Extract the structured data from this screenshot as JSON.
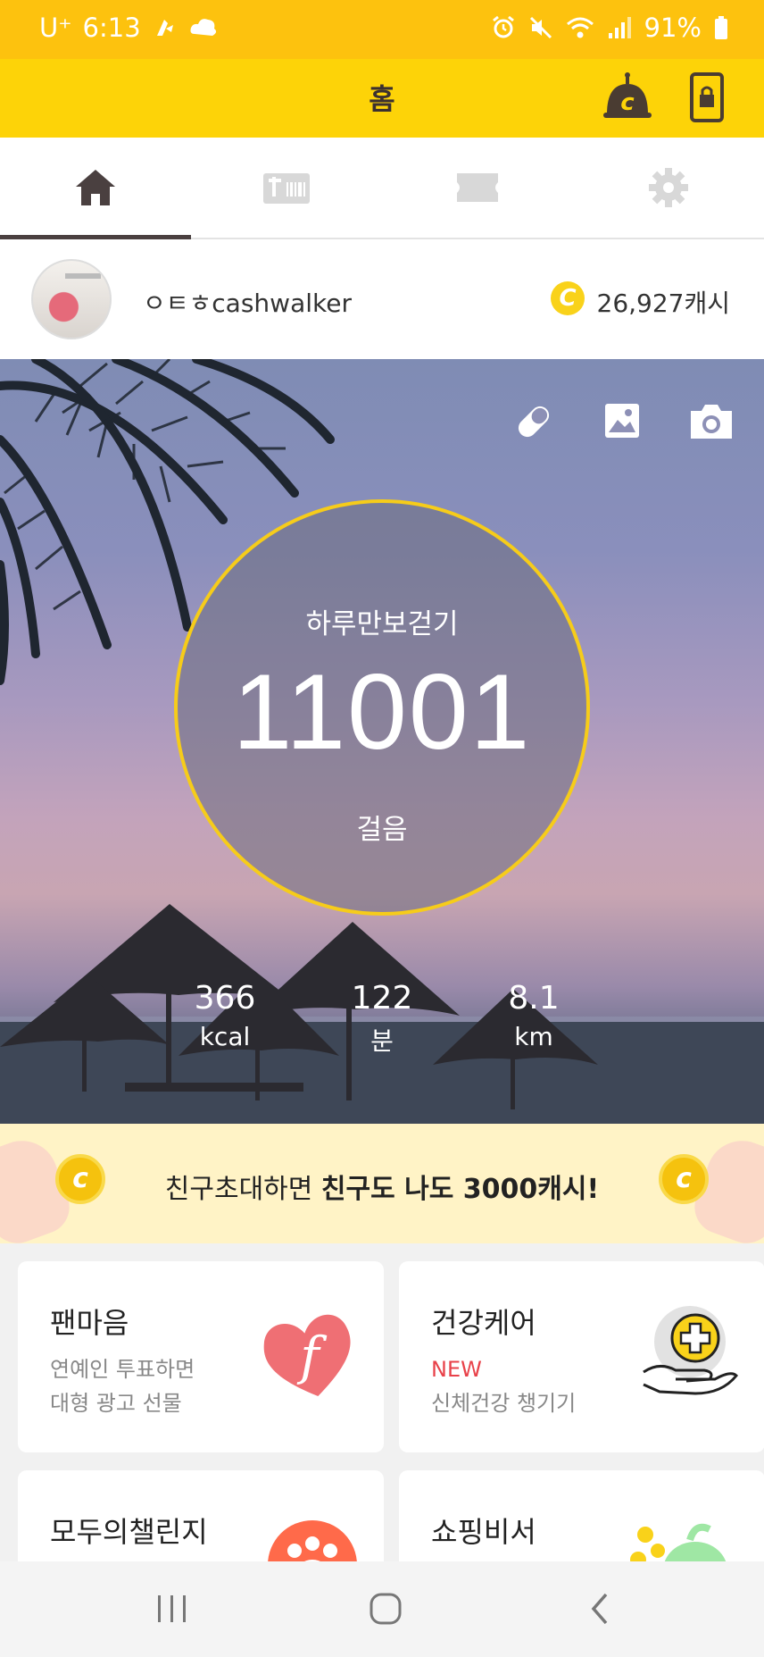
{
  "status_bar": {
    "carrier": "U⁺",
    "time": "6:13",
    "battery": "91%"
  },
  "app_bar": {
    "title": "홈"
  },
  "tabs": [
    {
      "name": "home",
      "icon": "home-icon",
      "active": true
    },
    {
      "name": "shop",
      "icon": "store-icon",
      "active": false
    },
    {
      "name": "coupon",
      "icon": "ticket-icon",
      "active": false
    },
    {
      "name": "settings",
      "icon": "gear-icon",
      "active": false
    }
  ],
  "profile": {
    "username": "ㅇㅌㅎcashwalker",
    "coin_symbol": "C",
    "cash": "26,927캐시"
  },
  "hero": {
    "goal_label": "하루만보걷기",
    "steps": "11001",
    "steps_unit": "걸음",
    "stats": [
      {
        "value": "366",
        "unit": "kcal"
      },
      {
        "value": "122",
        "unit": "분"
      },
      {
        "value": "8.1",
        "unit": "km"
      }
    ]
  },
  "banner": {
    "text_prefix": "친구초대하면 ",
    "text_bold": "친구도 나도 3000캐시!"
  },
  "cards": [
    {
      "title": "팬마음",
      "line1": "연예인 투표하면",
      "line2": "대형 광고 선물"
    },
    {
      "title": "건강케어",
      "line1": "NEW",
      "line2": "신체건강 챙기기"
    },
    {
      "title": "모두의챌린지"
    },
    {
      "title": "쇼핑비서"
    }
  ],
  "colors": {
    "status_bar": "#fdc20e",
    "app_bar": "#fdd308",
    "ring": "#f6cc1a",
    "banner": "#fff3c6",
    "new_badge": "#e8424a"
  }
}
